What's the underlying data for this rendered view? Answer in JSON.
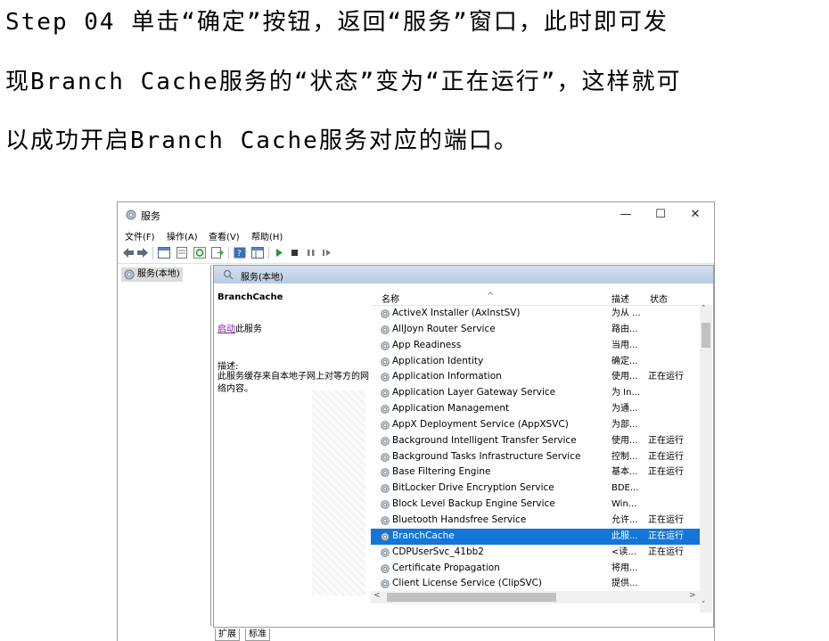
{
  "instruction": {
    "lines": [
      "Step 04  单击“确定”按钮，返回“服务”窗口，此时即可发",
      "现Branch Cache服务的“状态”变为“正在运行”，这样就可",
      "以成功开启Branch Cache服务对应的端口。"
    ]
  },
  "window": {
    "title": "服务",
    "controls": {
      "minimize": "—",
      "maximize": "☐",
      "close": "✕"
    }
  },
  "menubar": {
    "items": [
      "文件(F)",
      "操作(A)",
      "查看(V)",
      "帮助(H)"
    ]
  },
  "tree": {
    "root_label": "服务(本地)"
  },
  "panel_header": "服务(本地)",
  "details": {
    "service_name": "BranchCache",
    "start_link": "启动",
    "start_suffix": "此服务",
    "desc_label": "描述:",
    "desc_text": "此服务缓存来自本地子网上对等方的网络内容。"
  },
  "columns": {
    "name": "名称",
    "description": "描述",
    "status": "状态"
  },
  "services": [
    {
      "name": "ActiveX Installer (AxInstSV)",
      "desc": "为从 ...",
      "status": ""
    },
    {
      "name": "AllJoyn Router Service",
      "desc": "路由...",
      "status": ""
    },
    {
      "name": "App Readiness",
      "desc": "当用...",
      "status": ""
    },
    {
      "name": "Application Identity",
      "desc": "确定...",
      "status": ""
    },
    {
      "name": "Application Information",
      "desc": "使用...",
      "status": "正在运行"
    },
    {
      "name": "Application Layer Gateway Service",
      "desc": "为 In...",
      "status": ""
    },
    {
      "name": "Application Management",
      "desc": "为通...",
      "status": ""
    },
    {
      "name": "AppX Deployment Service (AppXSVC)",
      "desc": "为部...",
      "status": ""
    },
    {
      "name": "Background Intelligent Transfer Service",
      "desc": "使用...",
      "status": "正在运行"
    },
    {
      "name": "Background Tasks Infrastructure Service",
      "desc": "控制...",
      "status": "正在运行"
    },
    {
      "name": "Base Filtering Engine",
      "desc": "基本...",
      "status": "正在运行"
    },
    {
      "name": "BitLocker Drive Encryption Service",
      "desc": "BDE...",
      "status": ""
    },
    {
      "name": "Block Level Backup Engine Service",
      "desc": "Win...",
      "status": ""
    },
    {
      "name": "Bluetooth Handsfree Service",
      "desc": "允许...",
      "status": "正在运行"
    },
    {
      "name": "BranchCache",
      "desc": "此服...",
      "status": "正在运行",
      "selected": true
    },
    {
      "name": "CDPUserSvc_41bb2",
      "desc": "<读...",
      "status": "正在运行"
    },
    {
      "name": "Certificate Propagation",
      "desc": "将用...",
      "status": ""
    },
    {
      "name": "Client License Service (ClipSVC)",
      "desc": "提供...",
      "status": ""
    }
  ],
  "tabs": [
    "扩展",
    "标准"
  ],
  "colors": {
    "selection": "#1476d6",
    "header_band": "#c5d5ea",
    "link": "#7a1fa2"
  }
}
